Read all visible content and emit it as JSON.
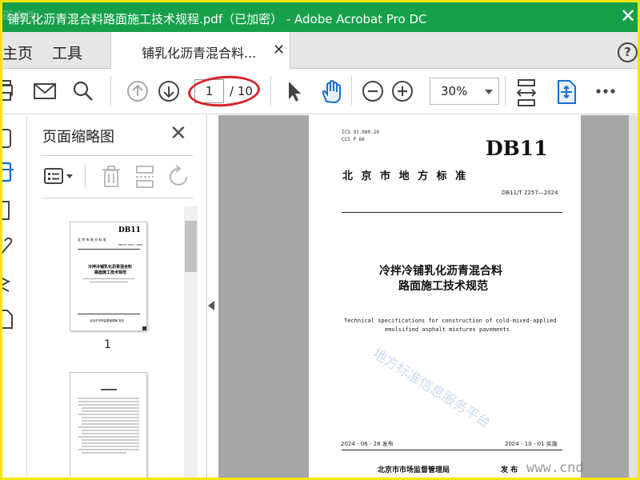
{
  "window": {
    "title": "铺乳化沥青混合料路面施工技术规程.pdf（已加密） - Adobe Acrobat Pro DC",
    "overlay_watermark": "砸文件"
  },
  "tabs": {
    "home": "主页",
    "tools": "工具",
    "document": "铺乳化沥青混合料...",
    "help_icon": "help-icon"
  },
  "toolbar": {
    "page_current": "1",
    "page_total": "/ 10",
    "zoom": "30%"
  },
  "panel": {
    "title": "页面缩略图",
    "thumb1_label": "1"
  },
  "thumb1": {
    "db": "DB11",
    "line1": "北  京  市  地  方  标  准",
    "code": "DB11/T 2257—2024",
    "title1": "冷拌冷铺乳化沥青混合料",
    "title2": "路面施工技术规范",
    "foot": "北京市市场监督管理局   发布"
  },
  "document": {
    "ics": "ICS 93.080.20",
    "ccs": "CCS P 66",
    "db": "DB11",
    "region": "北  京  市  地  方  标  准",
    "code": "DB11/T 2257—2024",
    "title_line1": "冷拌冷铺乳化沥青混合料",
    "title_line2": "路面施工技术规范",
    "en_line1": "Technical specifications for construction of cold-mixed-applied",
    "en_line2": "emulsified asphalt mixtures pavements",
    "publish_date": "2024 - 06 - 28 发布",
    "impl_date": "2024 - 10 - 01 实施",
    "issuer": "北京市市场监督管理局",
    "issue_word": "发  布"
  },
  "watermarks": {
    "center": "地方标准信息服务平台",
    "bottom_right": "www.cnd"
  },
  "colors": {
    "titlebar": "#16a04a",
    "accent_blue": "#1a6fd0",
    "annotation_red": "#d8232a",
    "frame_yellow": "#f3e600"
  }
}
